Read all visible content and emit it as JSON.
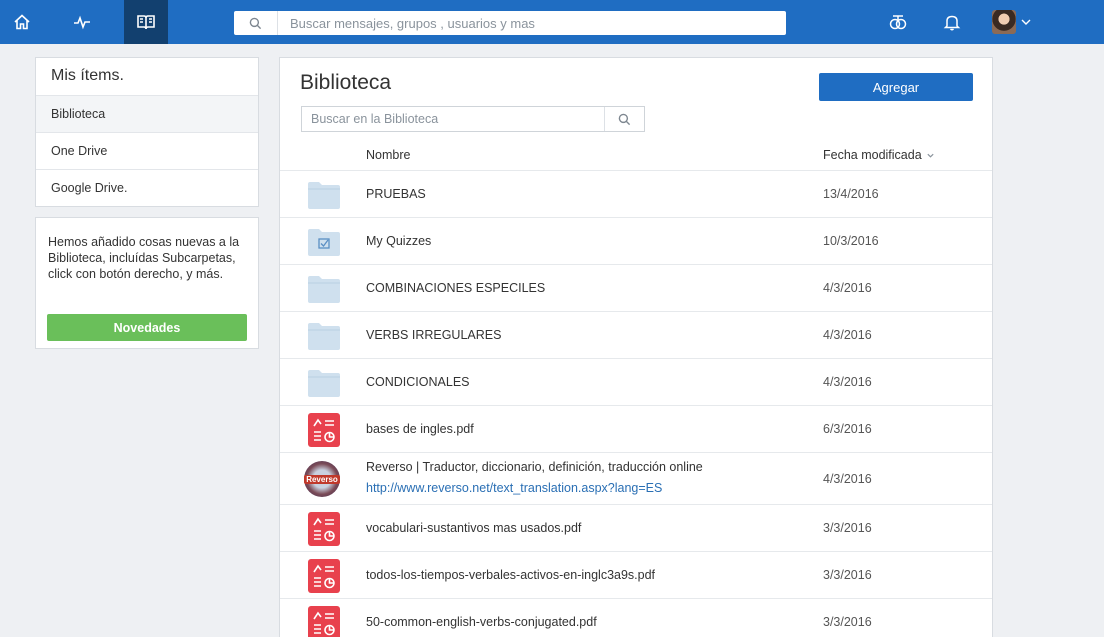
{
  "search": {
    "placeholder": "Buscar mensajes, grupos , usuarios y mas"
  },
  "sidebar": {
    "title": "Mis ítems.",
    "items": [
      {
        "label": "Biblioteca",
        "active": true
      },
      {
        "label": "One Drive",
        "active": false
      },
      {
        "label": "Google Drive.",
        "active": false
      }
    ]
  },
  "news": {
    "text": "Hemos añadido cosas nuevas a la Biblioteca, incluídas Subcarpetas, click con botón derecho, y más.",
    "button_label": "Novedades"
  },
  "main": {
    "title": "Biblioteca",
    "add_button": "Agregar",
    "search_placeholder": "Buscar en la Biblioteca",
    "col_name": "Nombre",
    "col_date": "Fecha modificada",
    "rows": [
      {
        "type": "folder",
        "icon": "folder-icon",
        "name": "PRUEBAS",
        "date": "13/4/2016"
      },
      {
        "type": "quiz-folder",
        "icon": "quiz-folder-icon",
        "name": "My Quizzes",
        "date": "10/3/2016"
      },
      {
        "type": "folder",
        "icon": "folder-icon",
        "name": "COMBINACIONES ESPECILES",
        "date": "4/3/2016"
      },
      {
        "type": "folder",
        "icon": "folder-icon",
        "name": "VERBS IRREGULARES",
        "date": "4/3/2016"
      },
      {
        "type": "folder",
        "icon": "folder-icon",
        "name": "CONDICIONALES",
        "date": "4/3/2016"
      },
      {
        "type": "pdf",
        "icon": "pdf-file-icon",
        "name": "bases de ingles.pdf",
        "date": "6/3/2016"
      },
      {
        "type": "link",
        "icon": "reverso-logo-icon",
        "logo_text": "Reverso",
        "name": "Reverso | Traductor, diccionario, definición, traducción online",
        "url": "http://www.reverso.net/text_translation.aspx?lang=ES",
        "date": "4/3/2016"
      },
      {
        "type": "pdf",
        "icon": "pdf-file-icon",
        "name": "vocabulari-sustantivos mas usados.pdf",
        "date": "3/3/2016"
      },
      {
        "type": "pdf",
        "icon": "pdf-file-icon",
        "name": "todos-los-tiempos-verbales-activos-en-inglc3a9s.pdf",
        "date": "3/3/2016"
      },
      {
        "type": "pdf",
        "icon": "pdf-file-icon",
        "name": "50-common-english-verbs-conjugated.pdf",
        "date": "3/3/2016"
      }
    ]
  },
  "colors": {
    "brand": "#1f6dc2",
    "nav_active": "#12406f",
    "success": "#6abf5a",
    "pdf": "#e8414d",
    "folder": "#cfe0ee"
  }
}
